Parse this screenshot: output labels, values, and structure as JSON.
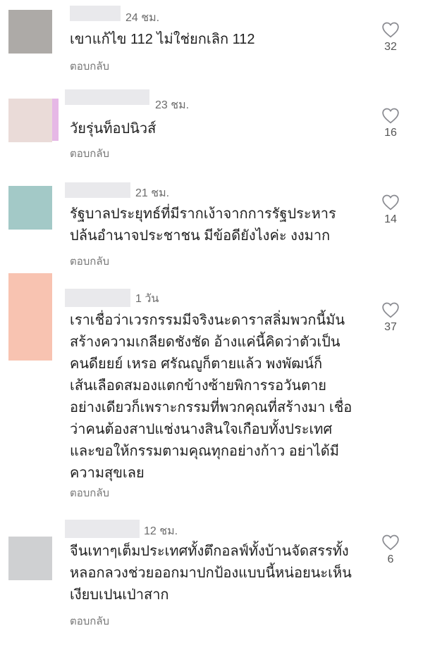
{
  "comments": [
    {
      "time": "24 ชม.",
      "lines": [
        "เขาแก้ไข 112 ไม่ใช่ยกเลิก 112"
      ],
      "reply": "ตอบกลับ",
      "likes": "32",
      "avatar_color": "#adaaa7"
    },
    {
      "time": "23 ชม.",
      "lines": [
        "วัยรุ่นท็อปนิวส์"
      ],
      "reply": "ตอบกลับ",
      "likes": "16",
      "avatar_color": "#eadbd8"
    },
    {
      "time": "21 ชม.",
      "lines": [
        "รัฐบาลประยุทธ์ที่มีรากเง้าจากการรัฐประหาร",
        "ปล้นอำนาจประชาชน มีข้อดียังไงค่ะ งงมาก"
      ],
      "reply": "ตอบกลับ",
      "likes": "14",
      "avatar_color": "#a3c9c7"
    },
    {
      "time": "1 วัน",
      "lines": [
        "เราเชื่อว่าเวรกรรมมีจริงนะดาราสลิ่มพวกนี้มัน",
        "สร้างความเกลียดชังชัด อ้างแค่นี้คิดว่าตัวเป็น",
        "คนดียยย์ เหรอ ศรัณญูก็ตายแล้ว พงพัฒน์ก็",
        "เส้นเลือดสมองแตกข้างซ้ายพิการรอวันตาย",
        "อย่างเดียวก็เพราะกรรมที่พวกคุณที่สร้างมา เชื่อ",
        "ว่าคนต้องสาปแช่งนางสินใจเกือบทั้งประเทศ",
        "และขอให้กรรมตามคุณทุกอย่างก้าว อย่าได้มี",
        "ความสุขเลย"
      ],
      "reply": "ตอบกลับ",
      "likes": "37",
      "avatar_color": "#f8c3b1"
    },
    {
      "time": "12 ชม.",
      "lines": [
        "จีนเทาๆเต็มประเทศทั้งตึกอลฟ์ทั้งบ้านจัดสรรทั้ง",
        "หลอกลวงช่วยออกมาปกป้องแบบนี้หน่อยนะเห็น",
        "เงียบเปนเป่าสาก"
      ],
      "reply": "ตอบกลับ",
      "likes": "6",
      "avatar_color": "#cfd0d2"
    }
  ]
}
